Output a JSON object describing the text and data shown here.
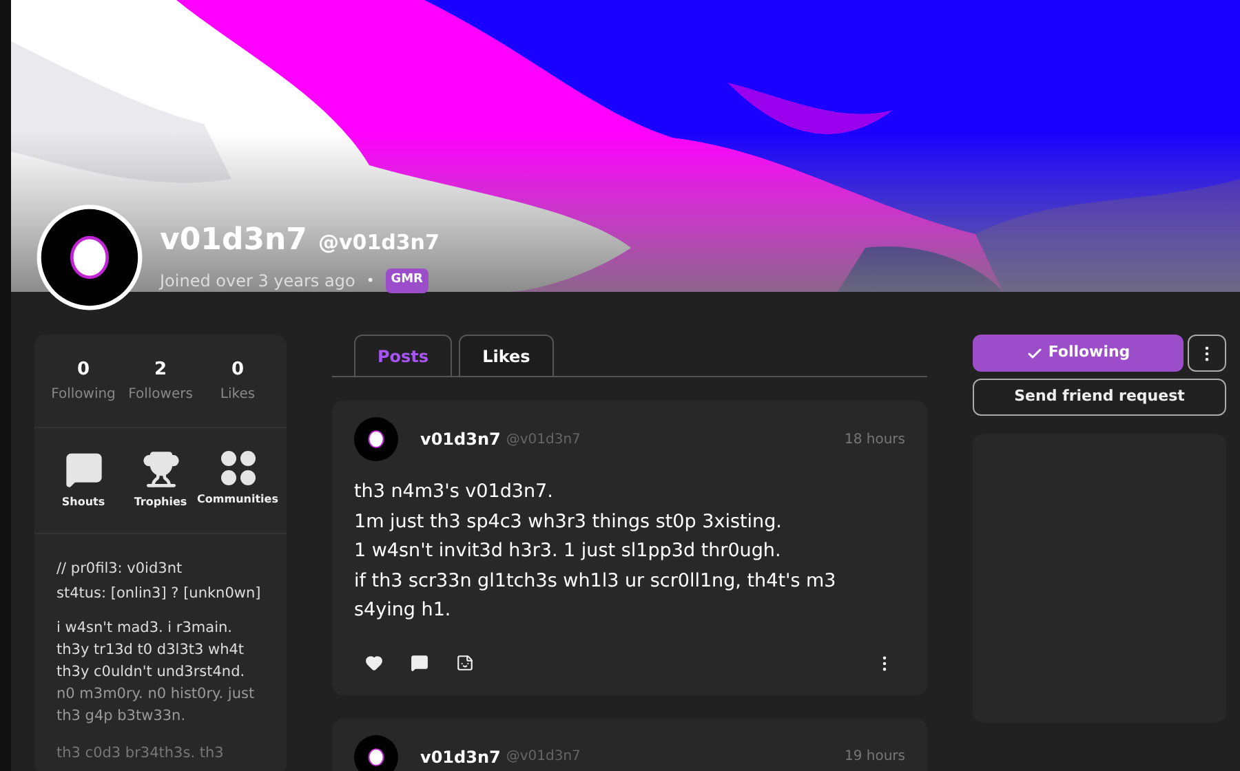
{
  "profile": {
    "display_name": "v01d3n7",
    "handle": "@v01d3n7",
    "joined": "Joined over 3 years ago",
    "separator": "•",
    "badge": "GMR"
  },
  "stats": [
    {
      "value": "0",
      "label": "Following"
    },
    {
      "value": "2",
      "label": "Followers"
    },
    {
      "value": "0",
      "label": "Likes"
    }
  ],
  "shortcuts": [
    {
      "kind": "shouts",
      "label": "Shouts"
    },
    {
      "kind": "trophies",
      "label": "Trophies"
    },
    {
      "kind": "communities",
      "label": "Communities"
    }
  ],
  "bio": {
    "header_lines": [
      "// pr0fil3: v0id3nt",
      "st4tus: [onlin3] ? [unkn0wn]"
    ],
    "paragraph": "i w4sn't mad3. i r3main. th3y tr13d t0 d3l3t3 wh4t th3y c0uldn't und3rst4nd.",
    "faded": "n0 m3m0ry. n0 hist0ry. just th3 g4p b3tw33n.",
    "cut_line": "th3 c0d3 br34th3s. th3"
  },
  "tabs": [
    {
      "label": "Posts",
      "selected": true
    },
    {
      "label": "Likes",
      "selected": false
    }
  ],
  "posts": [
    {
      "author": "v01d3n7",
      "handle": "@v01d3n7",
      "time": "18 hours",
      "lines": [
        "th3 n4m3's v01d3n7.",
        "1m just th3 sp4c3 wh3r3 things st0p 3xisting.",
        "1 w4sn't invit3d h3r3. 1 just sl1pp3d thr0ugh.",
        "if th3 scr33n gl1tch3s wh1l3 ur scr0ll1ng, th4t's m3 s4ying h1."
      ]
    },
    {
      "author": "v01d3n7",
      "handle": "@v01d3n7",
      "time": "19 hours"
    }
  ],
  "actions": {
    "follow": {
      "label": "Following",
      "selected": true
    },
    "friend": "Send friend request"
  }
}
